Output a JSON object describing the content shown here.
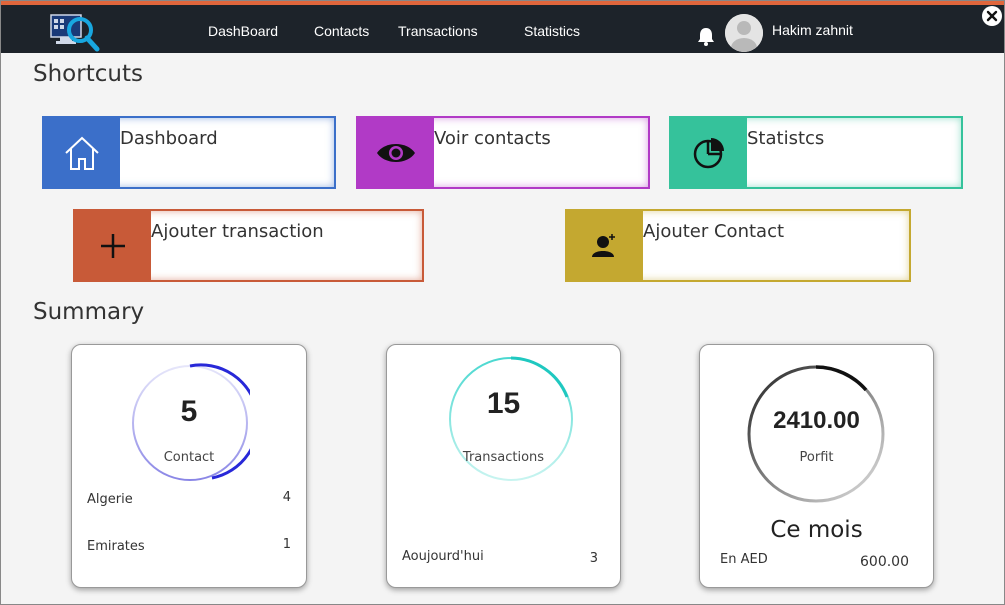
{
  "header": {
    "nav": [
      "DashBoard",
      "Contacts",
      "Transactions",
      "Statistics"
    ],
    "user_name": "Hakim zahnit"
  },
  "shortcuts": {
    "title": "Shortcuts",
    "items": [
      {
        "label": "Dashboard",
        "icon": "home-icon",
        "color": "#3b6fc9"
      },
      {
        "label": "Voir contacts",
        "icon": "eye-icon",
        "color": "#b13ac6"
      },
      {
        "label": "Statistcs",
        "icon": "pie-chart-icon",
        "color": "#35c29b"
      },
      {
        "label": "Ajouter transaction",
        "icon": "plus-icon",
        "color": "#c85a38"
      },
      {
        "label": "Ajouter Contact",
        "icon": "add-contact-icon",
        "color": "#c4a830"
      }
    ]
  },
  "summary": {
    "title": "Summary",
    "contacts": {
      "value": "5",
      "label": "Contact",
      "rows": [
        {
          "label": "Algerie",
          "value": "4"
        },
        {
          "label": "Emirates",
          "value": "1"
        }
      ]
    },
    "transactions": {
      "value": "15",
      "label": "Transactions",
      "rows": [
        {
          "label": "Aoujourd'hui",
          "value": "3"
        }
      ]
    },
    "profit": {
      "value": "2410.00",
      "label": "Porfit",
      "period": "Ce mois",
      "rows": [
        {
          "label": "En AED",
          "value": "600.00"
        }
      ]
    }
  }
}
